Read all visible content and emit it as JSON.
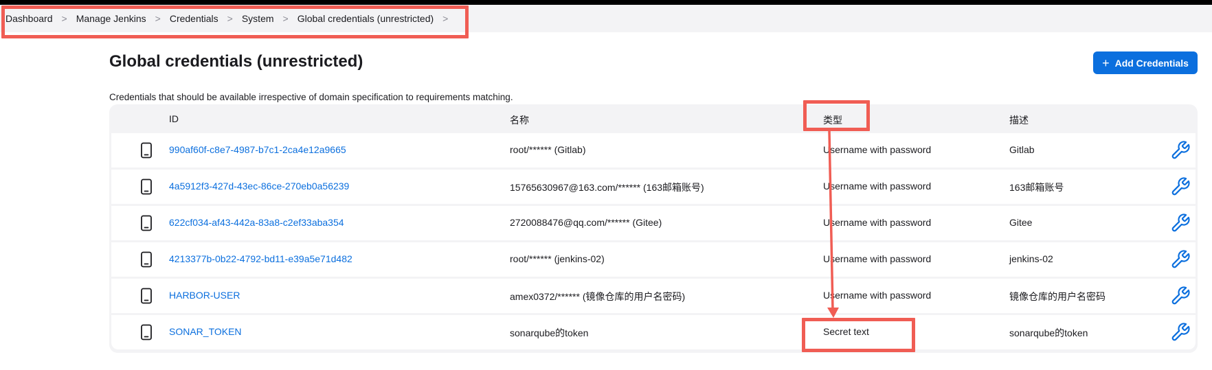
{
  "breadcrumb": {
    "items": [
      {
        "label": "Dashboard"
      },
      {
        "label": "Manage Jenkins"
      },
      {
        "label": "Credentials"
      },
      {
        "label": "System"
      },
      {
        "label": "Global credentials (unrestricted)"
      }
    ],
    "separator": ">"
  },
  "page": {
    "title": "Global credentials (unrestricted)",
    "add_button_label": "Add Credentials",
    "add_button_icon": "plus-icon",
    "description": "Credentials that should be available irrespective of domain specification to requirements matching."
  },
  "table": {
    "headers": {
      "id": "ID",
      "name": "名称",
      "type": "类型",
      "description": "描述"
    },
    "rows": [
      {
        "id": "990af60f-c8e7-4987-b7c1-2ca4e12a9665",
        "name": "root/****** (Gitlab)",
        "type": "Username with password",
        "description": "Gitlab"
      },
      {
        "id": "4a5912f3-427d-43ec-86ce-270eb0a56239",
        "name": "15765630967@163.com/****** (163邮箱账号)",
        "type": "Username with password",
        "description": "163邮箱账号"
      },
      {
        "id": "622cf034-af43-442a-83a8-c2ef33aba354",
        "name": "2720088476@qq.com/****** (Gitee)",
        "type": "Username with password",
        "description": "Gitee"
      },
      {
        "id": "4213377b-0b22-4792-bd11-e39a5e71d482",
        "name": "root/****** (jenkins-02)",
        "type": "Username with password",
        "description": "jenkins-02"
      },
      {
        "id": "HARBOR-USER",
        "name": "amex0372/****** (镜像仓库的用户名密码)",
        "type": "Username with password",
        "description": "镜像仓库的用户名密码"
      },
      {
        "id": "SONAR_TOKEN",
        "name": "sonarqube的token",
        "type": "Secret text",
        "description": "sonarqube的token"
      }
    ],
    "row_icon": "mobile-device-icon",
    "action_icon": "wrench-icon"
  },
  "colors": {
    "accent": "#0b6fde",
    "annotation": "#f05d54",
    "table_background": "#f3f3f5"
  }
}
